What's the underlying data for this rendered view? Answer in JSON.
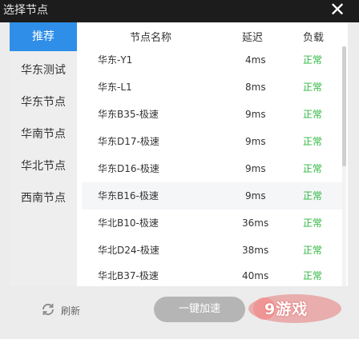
{
  "window": {
    "title": "选择节点"
  },
  "sidebar": {
    "items": [
      {
        "label": "推荐",
        "active": true
      },
      {
        "label": "华东测试"
      },
      {
        "label": "华东节点"
      },
      {
        "label": "华南节点"
      },
      {
        "label": "华北节点"
      },
      {
        "label": "西南节点"
      }
    ]
  },
  "table": {
    "headers": {
      "name": "节点名称",
      "latency": "延迟",
      "load": "负载"
    },
    "rows": [
      {
        "name": "华东-Y1",
        "latency": "4ms",
        "load": "正常"
      },
      {
        "name": "华东-L1",
        "latency": "8ms",
        "load": "正常"
      },
      {
        "name": "华东B35-极速",
        "latency": "9ms",
        "load": "正常"
      },
      {
        "name": "华东D17-极速",
        "latency": "9ms",
        "load": "正常"
      },
      {
        "name": "华东D16-极速",
        "latency": "9ms",
        "load": "正常"
      },
      {
        "name": "华东B16-极速",
        "latency": "9ms",
        "load": "正常"
      },
      {
        "name": "华北B10-极速",
        "latency": "36ms",
        "load": "正常"
      },
      {
        "name": "华北D24-极速",
        "latency": "38ms",
        "load": "正常"
      },
      {
        "name": "华北B37-极速",
        "latency": "40ms",
        "load": "正常"
      }
    ]
  },
  "footer": {
    "refresh_label": "刷新",
    "boost_label": "一键加速"
  },
  "watermark": {
    "text": "9游戏"
  },
  "colors": {
    "accent": "#2f8ee8",
    "status_ok": "#2db83d",
    "titlebar": "#1c1c1c"
  }
}
